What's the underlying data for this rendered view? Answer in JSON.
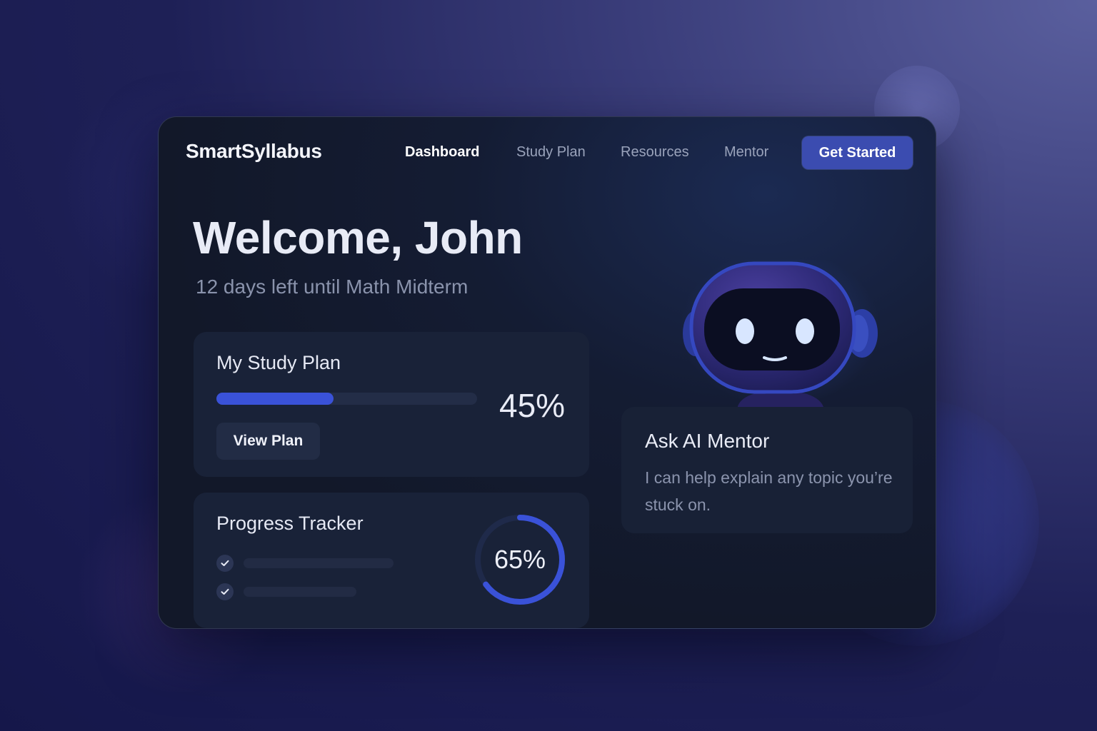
{
  "app": {
    "name": "SmartSyllabus"
  },
  "nav": {
    "items": [
      "Dashboard",
      "Study Plan",
      "Resources",
      "Mentor"
    ],
    "active": "Dashboard",
    "cta_label": "Get Started"
  },
  "hero": {
    "title": "Welcome, John",
    "subtitle": "12 days left until Math Midterm"
  },
  "study_plan": {
    "title": "My Study Plan",
    "progress": 45,
    "progress_label": "45%",
    "button_label": "View Plan"
  },
  "progress_tracker": {
    "title": "Progress Tracker",
    "completion": 65,
    "completion_label": "65%",
    "items_checked": [
      true,
      true
    ]
  },
  "mentor": {
    "title": "Ask AI Mentor",
    "description": "I can help explain any topic you’re stuck on."
  },
  "icons": {
    "check": "check-icon",
    "mascot": "robot-mascot-icon"
  },
  "colors": {
    "accent": "#3a52d8",
    "cta": "#3b4cb0",
    "window_bg": "#121829",
    "card_bg": "#192238"
  }
}
